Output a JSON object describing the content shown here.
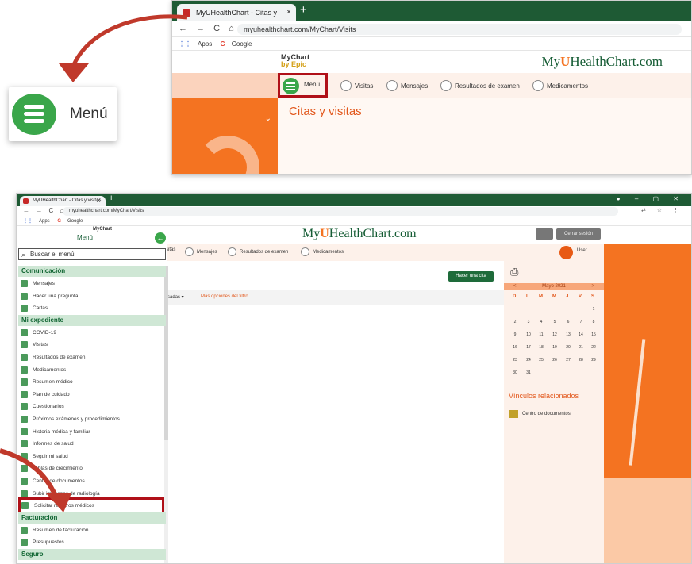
{
  "top_shot": {
    "tab_title": "MyUHealthChart - Citas y visitas",
    "tab_close": "×",
    "new_tab": "+",
    "url": "myuhealthchart.com/MyChart/Visits",
    "bookmarks": [
      "Apps",
      "Google"
    ],
    "mychart_logo": "MyChart",
    "mychart_by": "by Epic",
    "brand_left": "My",
    "brand_u": "U",
    "brand_right": "HealthChart.com",
    "menu_label": "Menú",
    "nav": [
      "Visitas",
      "Mensajes",
      "Resultados de examen",
      "Medicamentos"
    ],
    "page_title": "Citas y visitas",
    "chevron": "⌄"
  },
  "zoom_callout": {
    "menu_label": "Menú"
  },
  "bottom_shot": {
    "tab_title": "MyUHealthChart - Citas y visitas",
    "tab_close": "×",
    "new_tab": "+",
    "url": "myuhealthchart.com/MyChart/Visits",
    "bookmarks": [
      "Apps",
      "Google"
    ],
    "brand_left": "My",
    "brand_u": "U",
    "brand_right": "HealthChart.com",
    "logout": "Cerrar sesión",
    "user_name": "User",
    "nav_partial": "sitas",
    "nav": [
      "Mensajes",
      "Resultados de examen",
      "Medicamentos"
    ],
    "make_appointment": "Hacer una cita",
    "filter_select": "sadas ▾",
    "filter_more": "Más opciones del filtro",
    "calendar": {
      "month": "Mayo 2021",
      "prev": "<",
      "next": ">",
      "dow": [
        "D",
        "L",
        "M",
        "M",
        "J",
        "V",
        "S"
      ],
      "days": [
        "1",
        "2",
        "3",
        "4",
        "5",
        "6",
        "7",
        "8",
        "9",
        "10",
        "11",
        "12",
        "13",
        "14",
        "15",
        "16",
        "17",
        "18",
        "19",
        "20",
        "21",
        "22",
        "23",
        "24",
        "25",
        "26",
        "27",
        "28",
        "29",
        "30",
        "31"
      ]
    },
    "related_title": "Vínculos relacionados",
    "related_item": "Centro de documentos",
    "menu": {
      "title": "Menú",
      "logo": "MyChart",
      "back": "←",
      "search_placeholder": "Buscar el menú",
      "sections": [
        {
          "label": "Comunicación",
          "items": [
            "Mensajes",
            "Hacer una pregunta",
            "Cartas"
          ]
        },
        {
          "label": "Mi expediente",
          "items": [
            "COVID-19",
            "Visitas",
            "Resultados de examen",
            "Medicamentos",
            "Resumen médico",
            "Plan de cuidado",
            "Cuestionarios",
            "Próximos exámenes y procedimientos",
            "Historia médica y familiar",
            "Informes de salud",
            "Seguir mi salud",
            "Tablas de crecimiento",
            "Centro de documentos",
            "Subir imágenes de radiología",
            "Solicitar registros médicos"
          ]
        },
        {
          "label": "Facturación",
          "items": [
            "Resumen de facturación",
            "Presupuestos"
          ]
        },
        {
          "label": "Seguro",
          "items": []
        }
      ]
    }
  }
}
